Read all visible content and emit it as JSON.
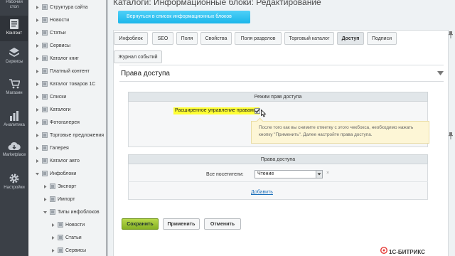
{
  "rail": {
    "items": [
      {
        "label1": "Рабочий",
        "label2": "стол",
        "icon": "desktop-icon"
      },
      {
        "label1": "Контент",
        "label2": "",
        "icon": "document-icon",
        "active": true
      },
      {
        "label1": "Сервисы",
        "label2": "",
        "icon": "layers-icon"
      },
      {
        "label1": "Магазин",
        "label2": "",
        "icon": "cart-icon"
      },
      {
        "label1": "Аналитика",
        "label2": "",
        "icon": "chart-icon"
      },
      {
        "label1": "Marketplace",
        "label2": "",
        "icon": "cloud-download-icon"
      },
      {
        "label1": "Настройки",
        "label2": "",
        "icon": "gear-icon"
      }
    ]
  },
  "tree": {
    "items": [
      {
        "label": "Структура сайта",
        "level": 0
      },
      {
        "label": "Новости",
        "level": 0
      },
      {
        "label": "Статьи",
        "level": 0
      },
      {
        "label": "Сервисы",
        "level": 0
      },
      {
        "label": "Каталог книг",
        "level": 0
      },
      {
        "label": "Платный контент",
        "level": 0
      },
      {
        "label": "Каталог товаров 1С",
        "level": 0
      },
      {
        "label": "Списки",
        "level": 0
      },
      {
        "label": "Каталоги",
        "level": 0
      },
      {
        "label": "Фотогалерея",
        "level": 0
      },
      {
        "label": "Торговые предложения",
        "level": 0
      },
      {
        "label": "Галерея",
        "level": 0
      },
      {
        "label": "Каталог авто",
        "level": 0
      },
      {
        "label": "Инфоблоки",
        "level": 0,
        "expanded": true
      },
      {
        "label": "Экспорт",
        "level": 1
      },
      {
        "label": "Импорт",
        "level": 1
      },
      {
        "label": "Типы инфоблоков",
        "level": 1,
        "expanded": true
      },
      {
        "label": "Новости",
        "level": 2
      },
      {
        "label": "Статьи",
        "level": 2
      },
      {
        "label": "Сервисы",
        "level": 2
      }
    ]
  },
  "page": {
    "title": "Каталоги: Информационные блоки: Редактирование",
    "back_button": "Вернуться в список информационных блоков"
  },
  "tabs": [
    {
      "label": "Инфоблок"
    },
    {
      "label": "SEO"
    },
    {
      "label": "Поля"
    },
    {
      "label": "Свойства"
    },
    {
      "label": "Поля разделов"
    },
    {
      "label": "Торговый каталог"
    },
    {
      "label": "Доступ",
      "active": true
    },
    {
      "label": "Подписи"
    }
  ],
  "tabs2": [
    {
      "label": "Журнал событий"
    }
  ],
  "section": {
    "title": "Права доступа",
    "mode_header": "Режим прав доступа",
    "extended_label": "Расширенное управление правами:",
    "extended_checked": true,
    "hint_line1": "После того как вы снимите отметку с этого чекбокса, необходимо нажать",
    "hint_line2": "кнопку \"Применить\". Далее настройте права доступа.",
    "rights_header": "Права доступа",
    "visitors_label": "Все посетители:",
    "visitors_value": "Чтение",
    "remove_mark": "×",
    "add_link": "Добавить"
  },
  "actions": {
    "save": "Сохранить",
    "apply": "Применить",
    "cancel": "Отменить"
  },
  "brand": {
    "name": "1С-БИТРИКС"
  },
  "colors": {
    "accent": "#2fc6f6",
    "save": "#9cc233",
    "highlight": "#ffff33",
    "hint_bg": "#fdf6d6"
  }
}
